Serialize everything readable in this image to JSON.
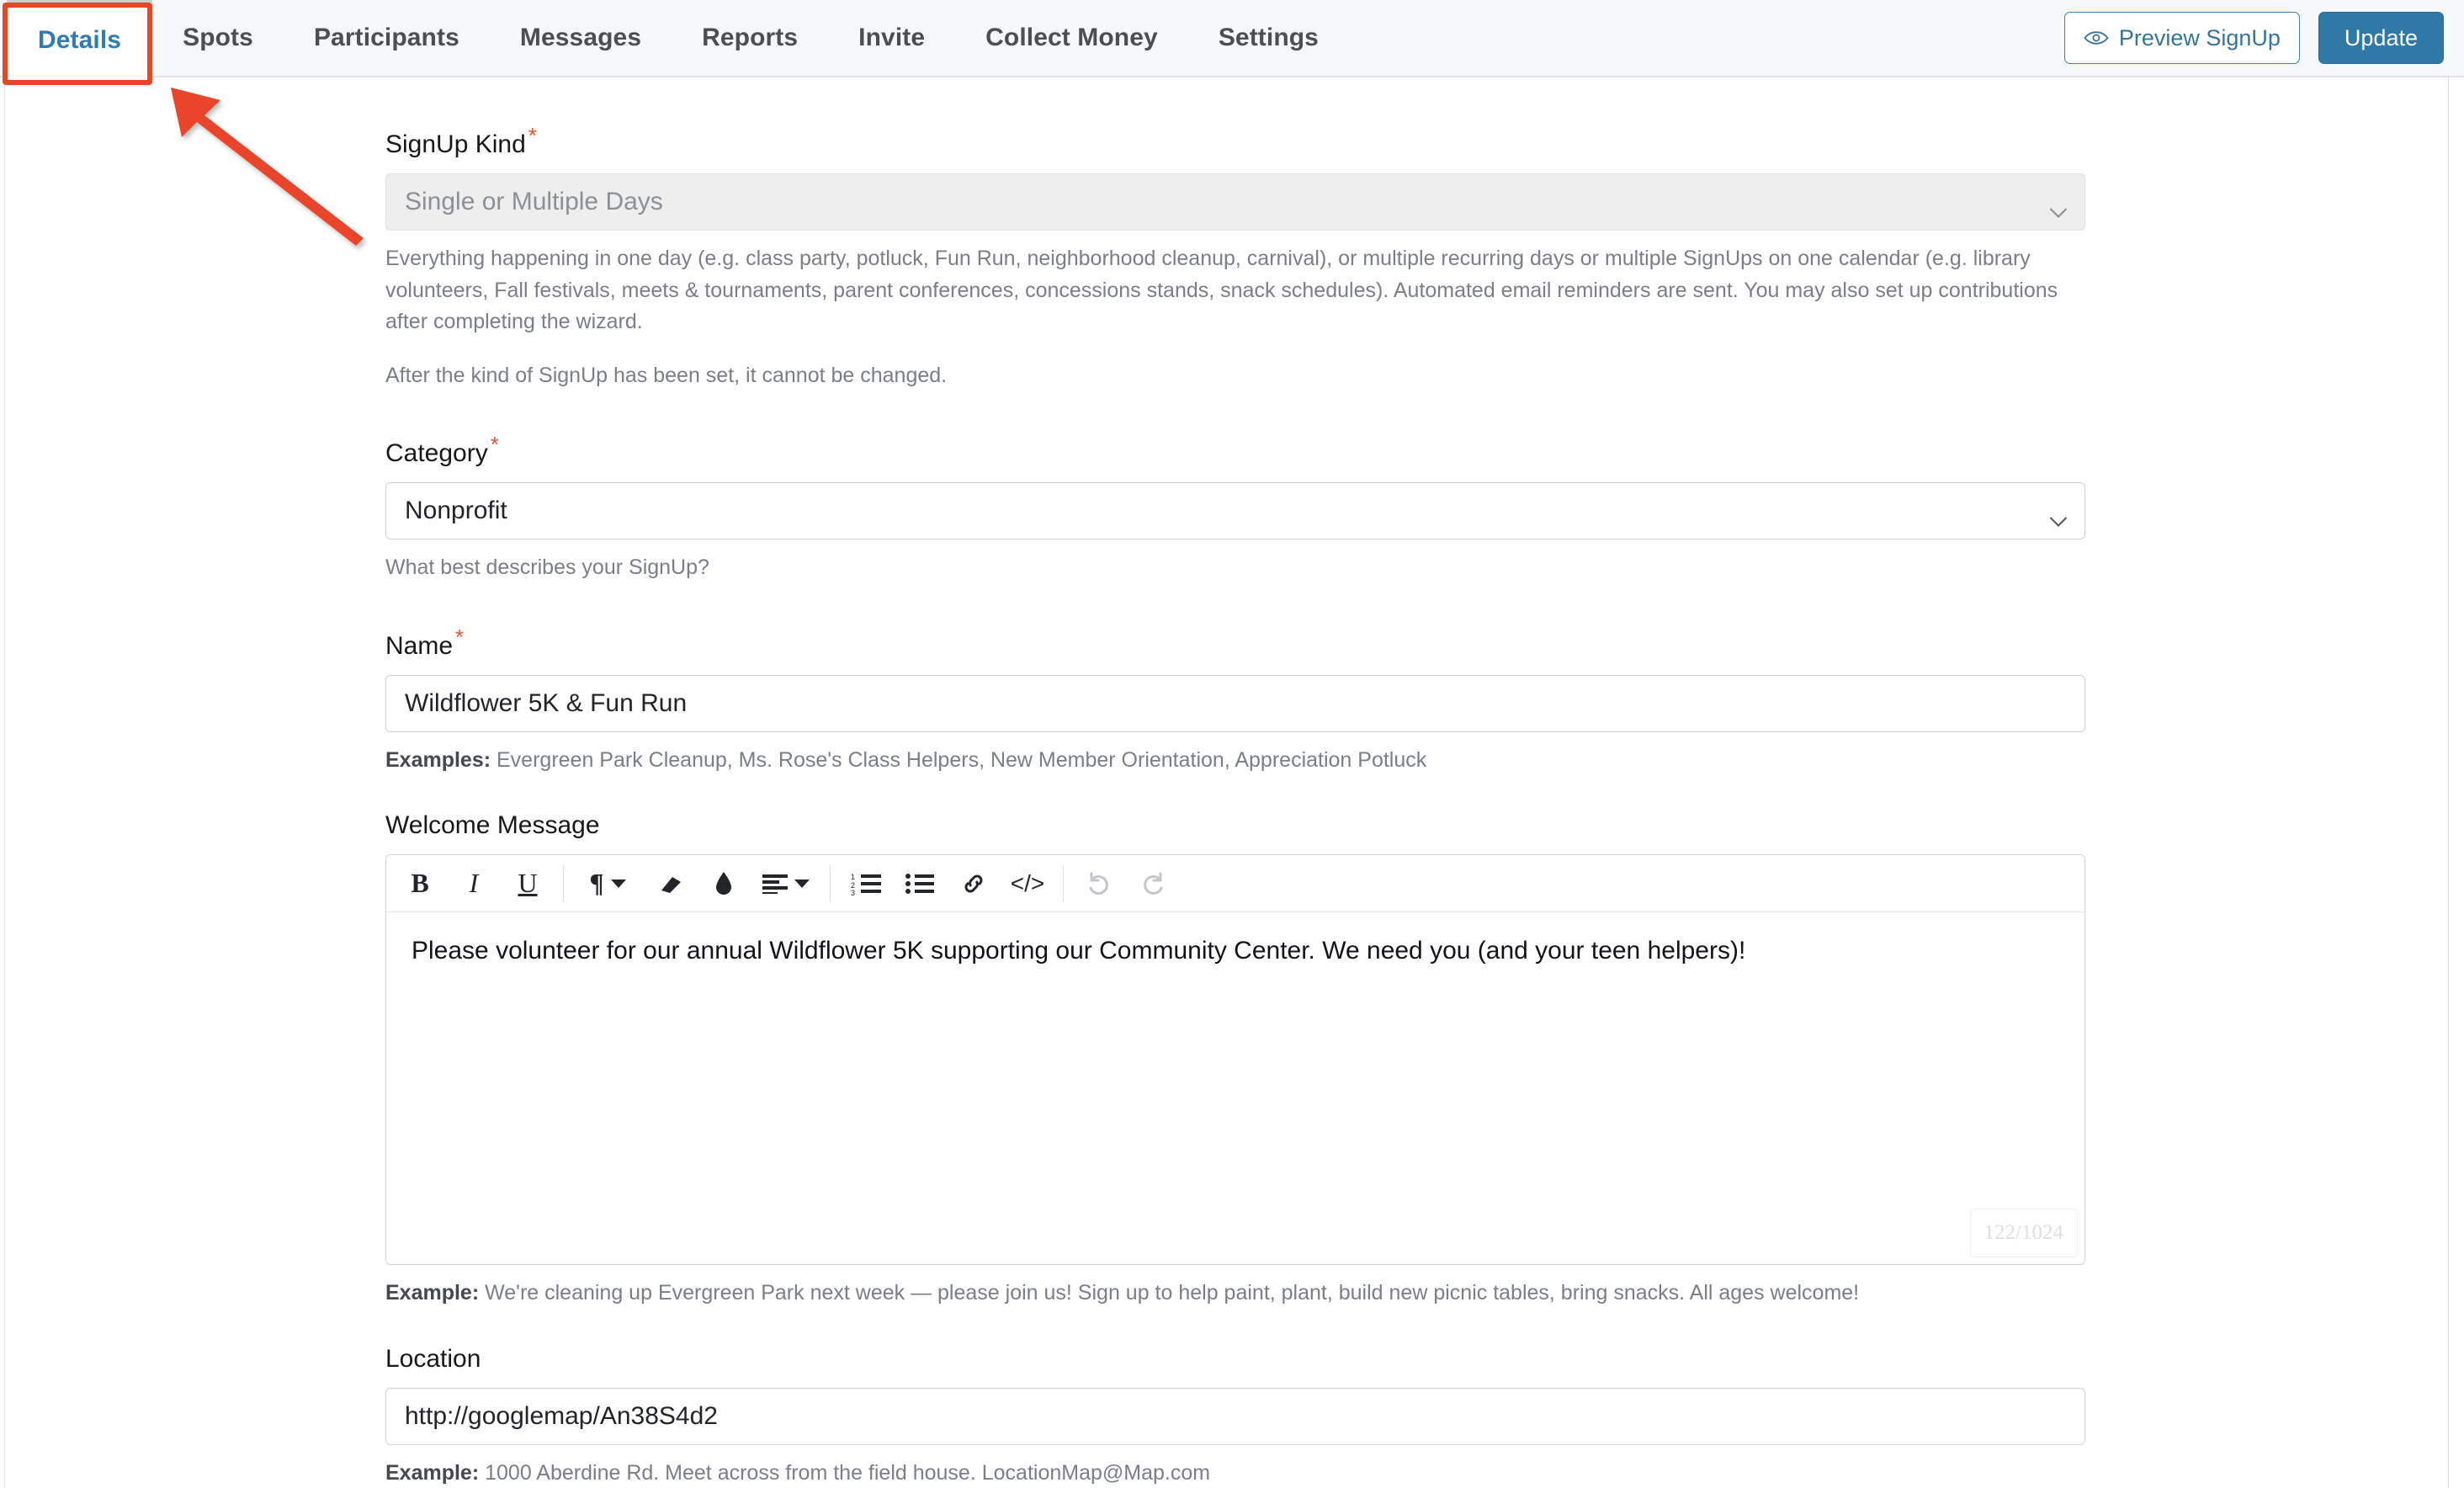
{
  "tabs": [
    {
      "label": "Details",
      "active": true
    },
    {
      "label": "Spots",
      "active": false
    },
    {
      "label": "Participants",
      "active": false
    },
    {
      "label": "Messages",
      "active": false
    },
    {
      "label": "Reports",
      "active": false
    },
    {
      "label": "Invite",
      "active": false
    },
    {
      "label": "Collect Money",
      "active": false
    },
    {
      "label": "Settings",
      "active": false
    }
  ],
  "header": {
    "preview_label": "Preview SignUp",
    "update_label": "Update",
    "preview_icon": "eye-icon",
    "accent_blue": "#2e79a8",
    "annotation_color": "#eb4524"
  },
  "form": {
    "signup_kind": {
      "label": "SignUp Kind",
      "required": "*",
      "value": "Single or Multiple Days",
      "disabled": true,
      "help_1": "Everything happening in one day (e.g. class party, potluck, Fun Run, neighborhood cleanup, carnival), or multiple recurring days or multiple SignUps on one calendar (e.g. library volunteers, Fall festivals, meets & tournaments, parent conferences, concessions stands, snack schedules). Automated email reminders are sent. You may also set up contributions after completing the wizard.",
      "help_2": "After the kind of SignUp has been set, it cannot be changed."
    },
    "category": {
      "label": "Category",
      "required": "*",
      "value": "Nonprofit",
      "help": "What best describes your SignUp?"
    },
    "name": {
      "label": "Name",
      "required": "*",
      "value": "Wildflower 5K & Fun Run",
      "example_prefix": "Examples:",
      "example_text": " Evergreen Park Cleanup, Ms. Rose's Class Helpers, New Member Orientation, Appreciation Potluck"
    },
    "welcome_message": {
      "label": "Welcome Message",
      "value": "Please volunteer for our annual Wildflower 5K supporting our Community Center. We need you (and your teen helpers)!",
      "counter": "122/1024",
      "example_prefix": "Example:",
      "example_text": " We're cleaning up Evergreen Park next week — please join us! Sign up to help paint, plant, build new picnic tables, bring snacks. All ages welcome!",
      "toolbar": [
        {
          "name": "bold-icon",
          "label": "B"
        },
        {
          "name": "italic-icon",
          "label": "I"
        },
        {
          "name": "underline-icon",
          "label": "U"
        },
        {
          "name": "paragraph-format-icon",
          "label": "¶"
        },
        {
          "name": "clear-formatting-icon",
          "label": "eraser"
        },
        {
          "name": "text-color-icon",
          "label": "droplet"
        },
        {
          "name": "align-icon",
          "label": "align"
        },
        {
          "name": "ordered-list-icon",
          "label": "123"
        },
        {
          "name": "unordered-list-icon",
          "label": "bullets"
        },
        {
          "name": "link-icon",
          "label": "link"
        },
        {
          "name": "code-view-icon",
          "label": "</>"
        },
        {
          "name": "undo-icon",
          "label": "undo"
        },
        {
          "name": "redo-icon",
          "label": "redo"
        }
      ]
    },
    "location": {
      "label": "Location",
      "value": "http://googlemap/An38S4d2",
      "example_prefix": "Example:",
      "example_text": " 1000 Aberdine Rd. Meet across from the field house. LocationMap@Map.com"
    }
  }
}
